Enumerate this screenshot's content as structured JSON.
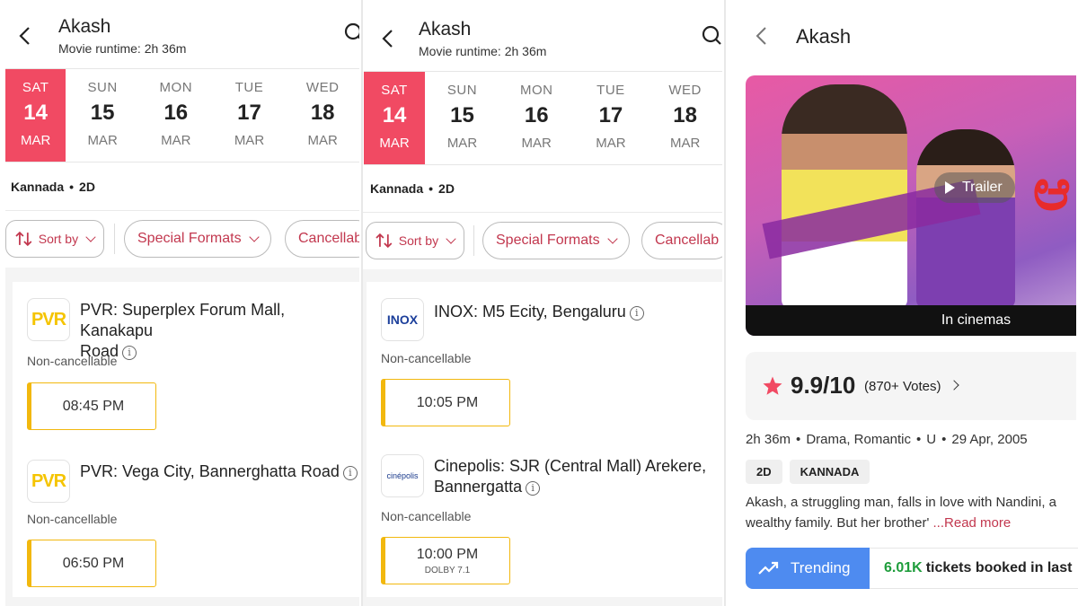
{
  "panels": [
    {
      "title": "Akash",
      "runtime": "Movie runtime: 2h 36m",
      "dates": [
        {
          "dow": "SAT",
          "num": "14",
          "mon": "MAR"
        },
        {
          "dow": "SUN",
          "num": "15",
          "mon": "MAR"
        },
        {
          "dow": "MON",
          "num": "16",
          "mon": "MAR"
        },
        {
          "dow": "TUE",
          "num": "17",
          "mon": "MAR"
        },
        {
          "dow": "WED",
          "num": "18",
          "mon": "MAR"
        }
      ],
      "language": "Kannada",
      "format": "2D",
      "filters": {
        "sort": "Sort by",
        "special": "Special Formats",
        "cancel": "Cancellab"
      },
      "cinemas": [
        {
          "logo": "PVR",
          "name_line1": "PVR: Superplex Forum Mall, Kanakapu",
          "name_line2": "Road",
          "note": "Non-cancellable",
          "time": "08:45 PM"
        },
        {
          "logo": "PVR",
          "name_line1": "PVR: Vega City, Bannerghatta Road",
          "note": "Non-cancellable",
          "time": "06:50 PM"
        }
      ]
    },
    {
      "title": "Akash",
      "runtime": "Movie runtime: 2h 36m",
      "dates": [
        {
          "dow": "SAT",
          "num": "14",
          "mon": "MAR"
        },
        {
          "dow": "SUN",
          "num": "15",
          "mon": "MAR"
        },
        {
          "dow": "MON",
          "num": "16",
          "mon": "MAR"
        },
        {
          "dow": "TUE",
          "num": "17",
          "mon": "MAR"
        },
        {
          "dow": "WED",
          "num": "18",
          "mon": "MAR"
        }
      ],
      "language": "Kannada",
      "format": "2D",
      "filters": {
        "sort": "Sort by",
        "special": "Special Formats",
        "cancel": "Cancellab"
      },
      "cinemas": [
        {
          "logo": "INOX",
          "name_line1": "INOX: M5 Ecity, Bengaluru",
          "note": "Non-cancellable",
          "time": "10:05 PM"
        },
        {
          "logo": "cinépolis",
          "name_line1": "Cinepolis: SJR (Central Mall) Arekere,",
          "name_line2": "Bannergatta",
          "note": "Non-cancellable",
          "time": "10:00 PM",
          "time_sub": "DOLBY 7.1"
        }
      ]
    }
  ],
  "detail": {
    "title": "Akash",
    "trailer": "Trailer",
    "in_cinemas": "In cinemas",
    "rating": "9.9/10",
    "votes": "(870+ Votes)",
    "duration": "2h 36m",
    "genre": "Drama, Romantic",
    "cert": "U",
    "release": "29 Apr, 2005",
    "tags": [
      "2D",
      "KANNADA"
    ],
    "desc_line1": "Akash, a struggling man, falls in love with Nandini, a",
    "desc_line2": "wealthy family. But her brother'",
    "read_more": "...Read more",
    "trending": "Trending",
    "booked_count": "6.01K",
    "booked_text": "tickets booked in last"
  },
  "colors": {
    "accent": "#f14a63",
    "accent_text": "#c2374e",
    "slot_border": "#f2b80e",
    "trend": "#4e8bf0",
    "green": "#1f9d3c"
  }
}
